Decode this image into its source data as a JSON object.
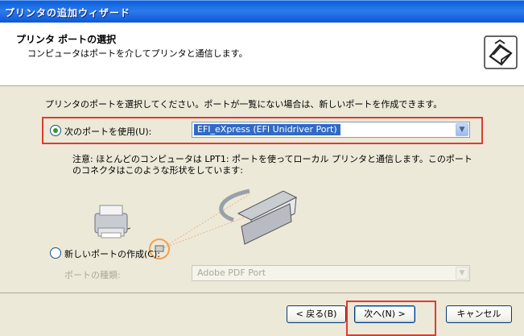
{
  "window": {
    "title": "プリンタの追加ウィザード"
  },
  "header": {
    "title": "プリンタ ポートの選択",
    "subtitle": "コンピュータはポートを介してプリンタと通信します。",
    "icon": "printer-wizard-icon"
  },
  "body": {
    "intro": "プリンタのポートを選択してください。ポートが一覧にない場合は、新しいポートを作成できます。",
    "use_port": {
      "label": "次のポートを使用(U):",
      "checked": true,
      "selected_value": "EFI_eXpress (EFI Unidriver Port)"
    },
    "note": "注意: ほとんどのコンピュータは LPT1: ポートを使ってローカル プリンタと通信します。このポートのコネクタはこのような形状をしています:",
    "new_port": {
      "label": "新しいポートの作成(C):",
      "checked": false,
      "type_label": "ポートの種類:",
      "type_value": "Adobe PDF Port"
    }
  },
  "buttons": {
    "back": "< 戻る(B)",
    "next": "次へ(N) >",
    "cancel": "キャンセル"
  },
  "colors": {
    "highlight_box": "#E23A2E",
    "title_bar": "#0A5FDC",
    "selection": "#316AC5"
  }
}
